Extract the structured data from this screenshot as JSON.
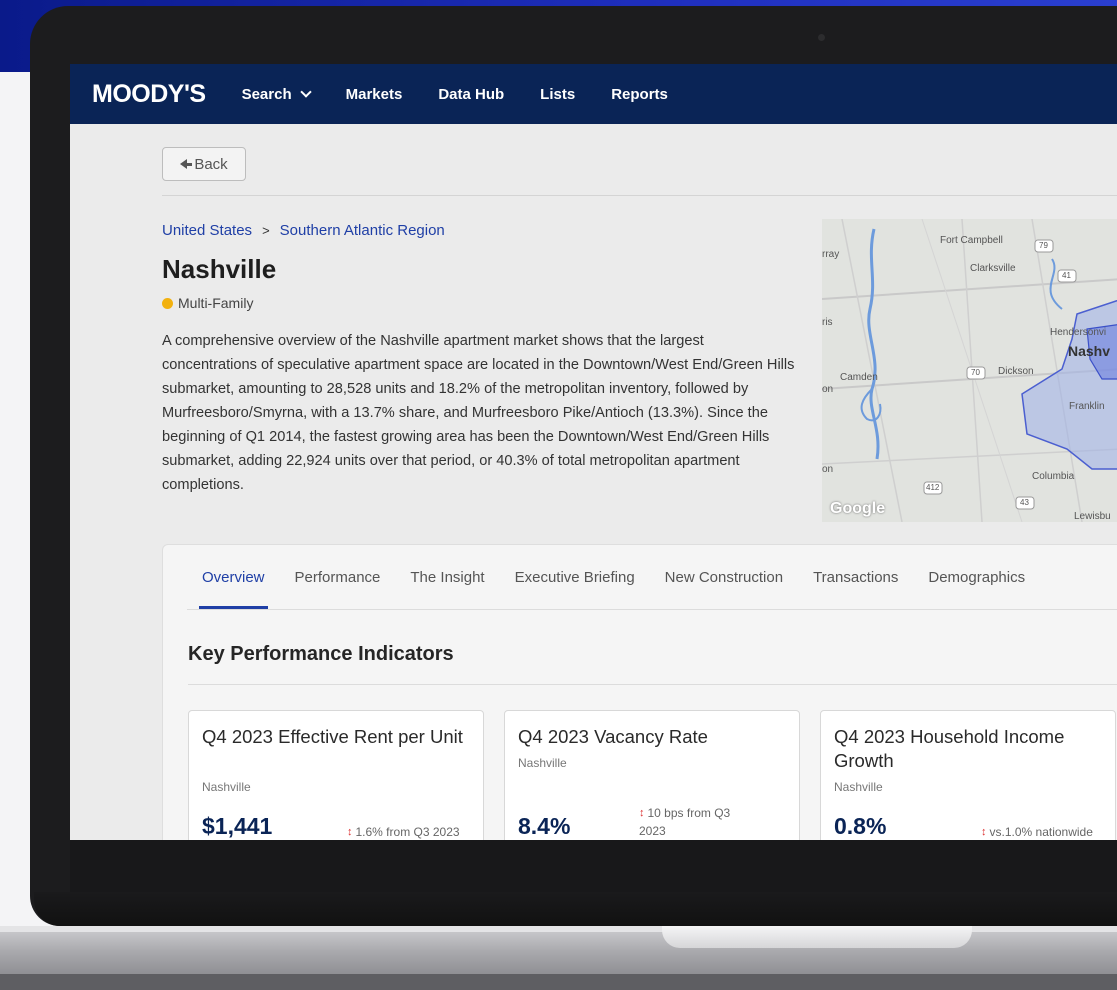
{
  "nav": {
    "logo": "MOODY'S",
    "items": [
      {
        "label": "Search",
        "has_dropdown": true
      },
      {
        "label": "Markets"
      },
      {
        "label": "Data Hub"
      },
      {
        "label": "Lists"
      },
      {
        "label": "Reports"
      }
    ]
  },
  "back_label": "Back",
  "breadcrumb": [
    "United States",
    "Southern Atlantic Region"
  ],
  "market": {
    "title": "Nashville",
    "tag": "Multi-Family",
    "description": "A comprehensive overview of the Nashville apartment market shows that the largest concentrations of speculative apartment space are located in the Downtown/West End/Green Hills submarket, amounting to 28,528 units and 18.2% of the metropolitan inventory, followed by Murfreesboro/Smyrna, with a 13.7% share, and Murfreesboro Pike/Antioch (13.3%). Since the beginning of Q1 2014, the fastest growing area has been the Downtown/West End/Green Hills submarket, adding 22,924 units over that period, or 40.3% of total metropolitan apartment completions."
  },
  "map": {
    "labels": [
      "Fort Campbell",
      "Clarksville",
      "Hendersonvi",
      "Nashv",
      "Camden",
      "Dickson",
      "Franklin",
      "Columbia",
      "Lewisbu",
      "rray",
      "ris",
      "on",
      "on"
    ],
    "road_numbers": [
      "79",
      "41",
      "70",
      "412",
      "43"
    ],
    "attribution": "Google"
  },
  "tabs": [
    "Overview",
    "Performance",
    "The Insight",
    "Executive Briefing",
    "New Construction",
    "Transactions",
    "Demographics"
  ],
  "kpi": {
    "title": "Key Performance Indicators",
    "cards": [
      {
        "title": "Q4 2023 Effective Rent per Unit",
        "location": "Nashville",
        "value": "$1,441",
        "delta_line1": "1.6% from Q3 2023",
        "delta_line2": ""
      },
      {
        "title": "Q4 2023 Vacancy Rate",
        "location": "Nashville",
        "value": "8.4%",
        "delta_line1": "10 bps from Q3",
        "delta_line2": "2023"
      },
      {
        "title": "Q4 2023 Household Income Growth",
        "location": "Nashville",
        "value": "0.8%",
        "delta_line1": "vs.1.0% nationwide",
        "delta_line2": ""
      }
    ]
  },
  "colors": {
    "nav_bg": "#0a2456",
    "accent": "#1f3fa6",
    "tag_dot": "#f2b10f",
    "value": "#0a2456"
  }
}
